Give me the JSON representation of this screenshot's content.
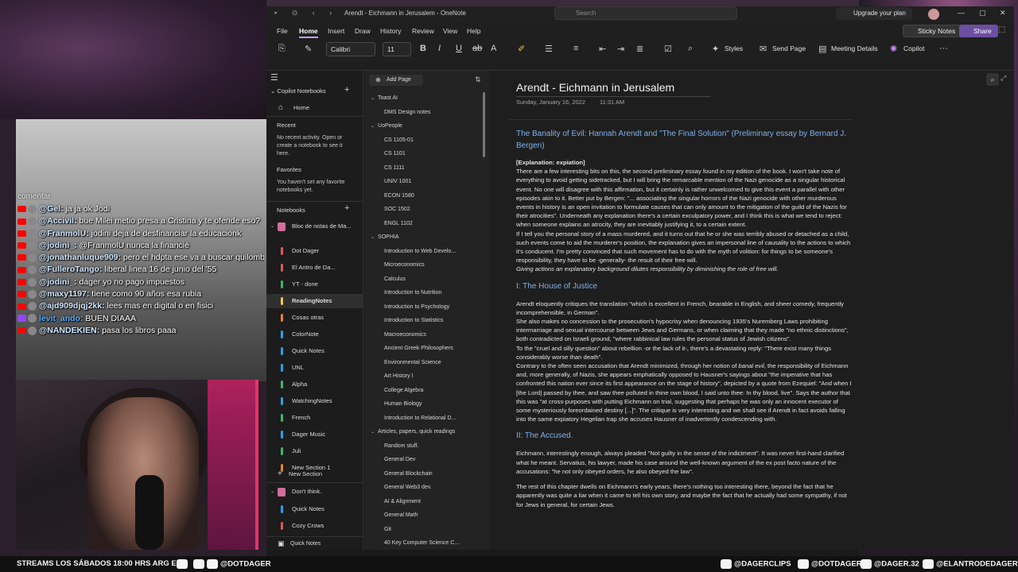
{
  "window": {
    "title": "Arendt - Eichmann in Jerusalem - OneNote",
    "search_placeholder": "Search",
    "upgrade_label": "Upgrade your plan"
  },
  "menu": {
    "tabs": [
      "File",
      "Home",
      "Insert",
      "Draw",
      "History",
      "Review",
      "View",
      "Help"
    ],
    "active_tab": "Home",
    "sticky_notes": "Sticky Notes",
    "share": "Share"
  },
  "ribbon": {
    "font": "Calibri",
    "size": "11",
    "styles": "Styles",
    "send_page": "Send Page",
    "meeting_details": "Meeting Details",
    "copilot": "Copilot"
  },
  "nav": {
    "copilot_notebooks": "Copilot Notebooks",
    "home": "Home",
    "recent_label": "Recent",
    "recent_note": "No recent activity. Open or create a notebook to see it here.",
    "favorites_label": "Favorites",
    "favorites_note": "You haven't set any favorite notebooks yet.",
    "notebooks_label": "Notebooks",
    "notebook_name": "Bloc de notas de Ma...",
    "sections": [
      {
        "label": "Dot Dager",
        "color": "#e0575b"
      },
      {
        "label": "El Antro de Da...",
        "color": "#e0575b"
      },
      {
        "label": "YT - done",
        "color": "#3fb56e"
      },
      {
        "label": "ReadingNotes",
        "color": "#f2c94c"
      },
      {
        "label": "Cosas otras",
        "color": "#e8812e"
      },
      {
        "label": "ColorNote",
        "color": "#2f9fe8"
      },
      {
        "label": "Quick Notes",
        "color": "#2f9fe8"
      },
      {
        "label": "UNL",
        "color": "#2f9fe8"
      },
      {
        "label": "Alpha",
        "color": "#3fb56e"
      },
      {
        "label": "WatchingNotes",
        "color": "#2f9fe8"
      },
      {
        "label": "French",
        "color": "#3fb56e"
      },
      {
        "label": "Dager Music",
        "color": "#2f9fe8"
      },
      {
        "label": "Juli",
        "color": "#3fb56e"
      },
      {
        "label": "New Section 1",
        "color": "#e8812e"
      }
    ],
    "new_section": "New Section",
    "second_notebook": "Don't think.",
    "second_sections": [
      {
        "label": "Quick Notes",
        "color": "#2f9fe8"
      },
      {
        "label": "Cozy Crows",
        "color": "#e0575b"
      }
    ],
    "quick_notes_footer": "Quick Notes"
  },
  "pages": {
    "add_page": "Add Page",
    "groups": [
      {
        "label": "Toast AI",
        "children": [
          "DMS Design notes"
        ]
      },
      {
        "label": "UoPeople",
        "children": [
          "CS 1105-01",
          "CS 1101",
          "CS 1111",
          "UNIV 1001",
          "ECON 1580",
          "SOC 1502",
          "ENGL 1102"
        ]
      },
      {
        "label": "SOPHIA",
        "children": [
          "Introduction to Web Develo...",
          "Microeconomics",
          "Calculus",
          "Introduction to Nutrition",
          "Introduction to Psychology",
          "Introduction to Statistics",
          "Macroeconomics",
          "Ancient Greek Philosophers",
          "Environmental Science",
          "Art History I",
          "College Algebra",
          "Human Biology",
          "Introduction to Relational D..."
        ]
      },
      {
        "label": "Articles, papers, quick readings",
        "children": [
          "Random stuff.",
          "General Dev",
          "General Blockchain",
          "General Web3 dev.",
          "AI & Alignment",
          "General Math",
          "Git",
          "40 Key Computer Science C..."
        ]
      }
    ]
  },
  "page": {
    "title": "Arendt - Eichmann in Jerusalem",
    "date": "Sunday, January 16, 2022",
    "time": "11:31 AM",
    "heading1": "The Banality of Evil: Hannah Arendt and \"The Final Solution\" (Preliminary essay by Bernard J. Bergen)",
    "explanation_label": "[Explanation: expiation]",
    "para1": "There are a few interesting bits on this, the second preliminary essay found in my edition of the book. I won't take note of everything to avoid getting sidetracked, but I will bring the remarcable mention of the Nazi genocide as a singular historical event. No one will disagree with this affirmation, but it certainly is rather unwelcomed to give this event a parallel with other episodes akin to it. Better put by Bergen: \"... associating the singular horrors of the Nazi genocide with other murderous events in history is an open invitation to formulate causes that can only amount to the mitigation of the guild of the Nazis for their atrocities\". Underneath any explanation there's a certain exculpatory power, and I think this is what we tend to reject: when someone explains an atrocity, they are inevitably justifying it, to a certain extent.",
    "para2": "If I tell you the personal story of a mass murdered, and it turns out that he or she was terribly abused or detached as a child, such events come to aid the murderer's position, the explanation gives an impersonal line of causality to the actions to which it's conducent. I'm pretty convinced that such movement has to do with the myth of volition: for things to be someone's responsibility, they have to be -generally- the result of their free will.",
    "para2_italic": "Giving actions an explanatory background dilutes responsibility by diminishing the role of free will.",
    "heading2": "I: The House of Justice",
    "para3": "Arendt eloquently critiques the translation \"which is excellent in French, bearable in English, and sheer comedy, frequently incomprehensible, in German\".",
    "para4": "She also makes no concession to the prosecution's hypocrisy when denouncing 1935's Nuremberg Laws prohibiting intermarriage and sexual intercourse between Jews and Germans, or when claiming that they made \"no ethnic distinctions\", both contradicted on Israeli ground, \"where rabbinical law rules the personal status of Jewish citizens\".",
    "para5": "To the \"cruel and silly question\" about rebellion -or the lack of it-, there's a devastating reply: \"There exist many things considerably worse than death\".",
    "para6_a": "Contrary to the often seen accusation that Arendt minimized, through her notion of ",
    "para6_em": "banal evil",
    "para6_b": ", the responsibility of Eichmann and, more generally, of Nazis, she appears emphatically opposed to Hausner's sayings about \"the imperative that has confronted this nation ever since its first appearance on the stage of history\", depicted by a quote from Ezequiel: \"And when I [the Lord] passed by thee, and saw thee polluted in thine own blood, I said unto thee: In thy blood, live\". Says the author that this was \"at cross-purposes with putting Eichmann on trial, suggesting that perhaps he was only an innocent executor of some mysteriously foreordained destiny [...]\". The critique is very interesting and we shall see if Arendt in fact avoids falling into the same expiatory Hegelian trap she accuses Hausner of inadvertently condescending with.",
    "heading3": "II: The Accused.",
    "para7": "Eichmann, interestingly enough, always pleaded \"Not guilty in the sense of the indictment\". It was never first-hand clarified what he meant. Servatius, his lawyer, made his case around the well-known argument of the ex post facto nature of the accusations: \"he not only obeyed orders, he also obeyed the law\".",
    "para8": "The rest of this chapter dwells on Eichmann's early years; there's nothing too interesting there, beyond the fact that he apparently was quite a liar when it came to tell his own story, and maybe the fact that he actually had some sympathy, if not for Jews in general, for certain Jews."
  },
  "stream": {
    "chat_header": "comentar",
    "chat": [
      {
        "platform": "yt",
        "user": "@Gel:",
        "msg": " ja ja ok Jodi"
      },
      {
        "platform": "yt",
        "user": "@Accivil:",
        "msg": " bue Milei metio presa a Cristina y te ofende eso?"
      },
      {
        "platform": "yt",
        "user": "@FranmolU:",
        "msg": " jodini deja de desfinanciar la educacionk"
      },
      {
        "platform": "yt",
        "user": "@jodini_:",
        "msg": " @FranmolU nunca la financié"
      },
      {
        "platform": "yt",
        "user": "@jonathanluque909:",
        "msg": " pero el hdpta ese va a buscar quilombo"
      },
      {
        "platform": "yt",
        "user": "@FulleroTango:",
        "msg": " liberal linea 16 de junio del '55"
      },
      {
        "platform": "yt",
        "user": "@jodini_:",
        "msg": " dager yo no pago impuestos"
      },
      {
        "platform": "yt",
        "user": "@maxy1197:",
        "msg": " tiene como 90 años esa rubia"
      },
      {
        "platform": "yt",
        "user": "@ajd909djqj2kk:",
        "msg": " lees mas en digital o en fisici"
      },
      {
        "platform": "tw",
        "user": "levit_ando:",
        "msg": " BUEN DIAAA"
      },
      {
        "platform": "yt",
        "user": "@NANDEKIEN:",
        "msg": " pasa los libros paaa"
      }
    ],
    "schedule": "STREAMS LOS SÁBADOS 18:00 HRS ARG EN",
    "handle1": "@DOTDAGER",
    "handle2": "@DAGERCLIPS",
    "handle3": "@DOTDAGER",
    "handle4": "@DAGER.32",
    "handle5": "@ELANTRODEDAGER"
  }
}
